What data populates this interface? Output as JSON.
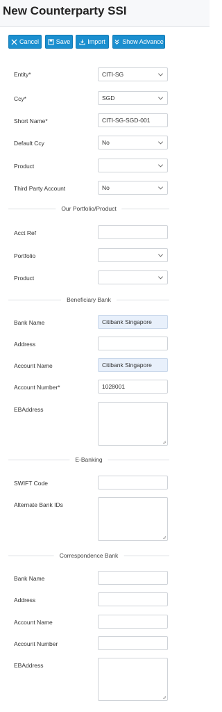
{
  "page": {
    "title": "New Counterparty SSI"
  },
  "toolbar": {
    "cancel": "Cancel",
    "save": "Save",
    "import": "Import",
    "show_advance": "Show Advance"
  },
  "general": {
    "entity": {
      "label": "Entity*",
      "value": "CITI-SG"
    },
    "ccy": {
      "label": "Ccy*",
      "value": "SGD"
    },
    "short_name": {
      "label": "Short Name*",
      "value": "CITI-SG-SGD-001"
    },
    "default_ccy": {
      "label": "Default Ccy",
      "value": "No"
    },
    "product": {
      "label": "Product",
      "value": ""
    },
    "third_party": {
      "label": "Third Party Account",
      "value": "No"
    }
  },
  "portfolio": {
    "heading": "Our Portfolio/Product",
    "acct_ref": {
      "label": "Acct Ref",
      "value": ""
    },
    "portfolio": {
      "label": "Portfolio",
      "value": ""
    },
    "product": {
      "label": "Product",
      "value": ""
    }
  },
  "beneficiary": {
    "heading": "Beneficiary Bank",
    "bank_name": {
      "label": "Bank Name",
      "value": "Citibank Singapore"
    },
    "address": {
      "label": "Address",
      "value": ""
    },
    "account_name": {
      "label": "Account Name",
      "value": "Citibank Singapore"
    },
    "account_number": {
      "label": "Account Number*",
      "value": "1028001"
    },
    "ebaddress": {
      "label": "EBAddress",
      "value": ""
    }
  },
  "ebanking": {
    "heading": "E-Banking",
    "swift": {
      "label": "SWIFT Code",
      "value": ""
    },
    "alt_ids": {
      "label": "Alternate Bank IDs",
      "value": ""
    }
  },
  "correspondence": {
    "heading": "Correspondence Bank",
    "bank_name": {
      "label": "Bank Name",
      "value": ""
    },
    "address": {
      "label": "Address",
      "value": ""
    },
    "account_name": {
      "label": "Account Name",
      "value": ""
    },
    "account_number": {
      "label": "Account Number",
      "value": ""
    },
    "ebaddress": {
      "label": "EBAddress",
      "value": ""
    }
  },
  "colors": {
    "accent": "#1b8fcf",
    "filled_field": "#e8f0fb"
  }
}
